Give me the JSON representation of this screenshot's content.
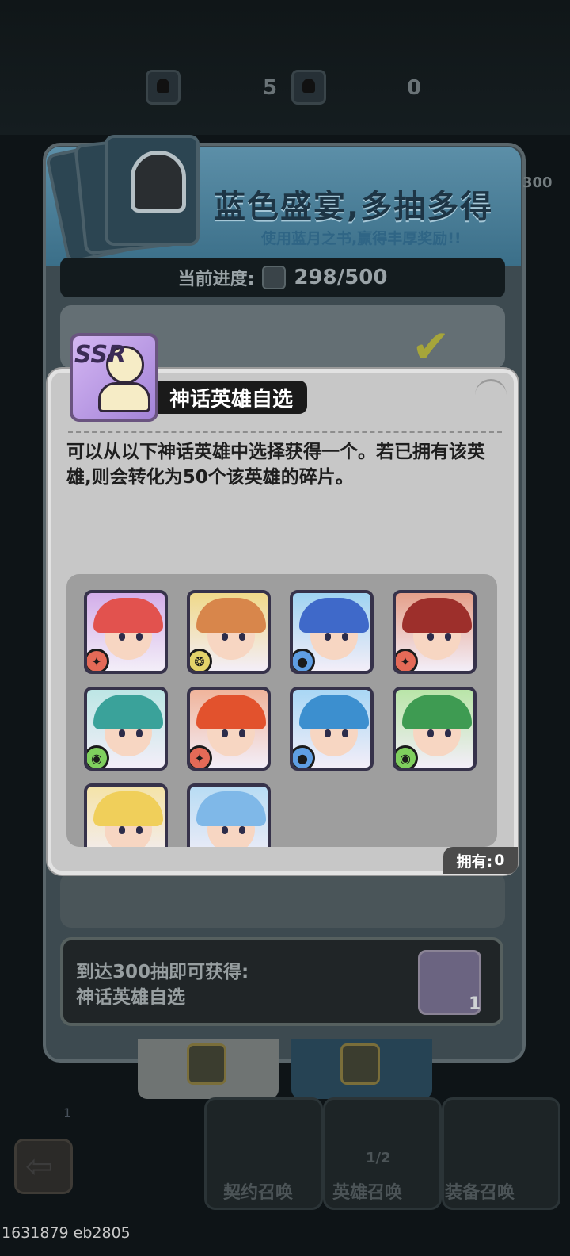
{
  "top_currency": {
    "book_grey_count": "5",
    "book_gold_count": "0"
  },
  "event": {
    "title": "蓝色盛宴,多抽多得",
    "subtitle": "使用蓝月之书,赢得丰厚奖励!!",
    "progress_label": "当前进度:",
    "progress_value": "298/500",
    "side_value": "300"
  },
  "popup": {
    "badge": "SSR",
    "title": "神话英雄自选",
    "description": "可以从以下神话英雄中选择获得一个。若已拥有该英雄,则会转化为50个该英雄的碎片。",
    "owned_label": "拥有:",
    "owned_value": "0",
    "heroes": [
      {
        "name": "hero-fire-red-hair",
        "element": "fire",
        "hair": "#e2524e",
        "bg": "#d3aee9"
      },
      {
        "name": "hero-light-tiger",
        "element": "light",
        "hair": "#d8864b",
        "bg": "#f0d98a"
      },
      {
        "name": "hero-water-blue-hair",
        "element": "water",
        "hair": "#3f69c9",
        "bg": "#9fd3f1"
      },
      {
        "name": "hero-fire-warrior",
        "element": "fire",
        "hair": "#9d2f2b",
        "bg": "#e5a08a"
      },
      {
        "name": "hero-wind-teal-elf",
        "element": "wind",
        "hair": "#3aa29a",
        "bg": "#bde6e5"
      },
      {
        "name": "hero-fire-dragon-mask",
        "element": "fire",
        "hair": "#e2522d",
        "bg": "#f0b49b"
      },
      {
        "name": "hero-water-blue-swordsman",
        "element": "water",
        "hair": "#3c8fcf",
        "bg": "#a9d7f5"
      },
      {
        "name": "hero-wind-green-mage",
        "element": "wind",
        "hair": "#3e9b52",
        "bg": "#b9e5a8"
      },
      {
        "name": "hero-blonde",
        "element": "light",
        "hair": "#f0cf5a",
        "bg": "#f4e3a8"
      },
      {
        "name": "hero-blue-elf",
        "element": "water",
        "hair": "#7fb8e8",
        "bg": "#b8dcf4"
      }
    ]
  },
  "milestone": {
    "line1": "到达300抽即可获得:",
    "line2": "神话英雄自选",
    "reward_count": "1"
  },
  "bottom_nav": {
    "contract": "契约召唤",
    "hero": "英雄召唤",
    "equip": "装备召唤",
    "hero_count": "1/2",
    "side_count": "1"
  },
  "footer_id": "1631879 eb2805",
  "element_colors": {
    "fire": "#e46a57",
    "light": "#e4d36a",
    "water": "#5f9ee3",
    "wind": "#7fcf5e"
  },
  "element_glyphs": {
    "fire": "✦",
    "light": "❂",
    "water": "●",
    "wind": "◉"
  }
}
